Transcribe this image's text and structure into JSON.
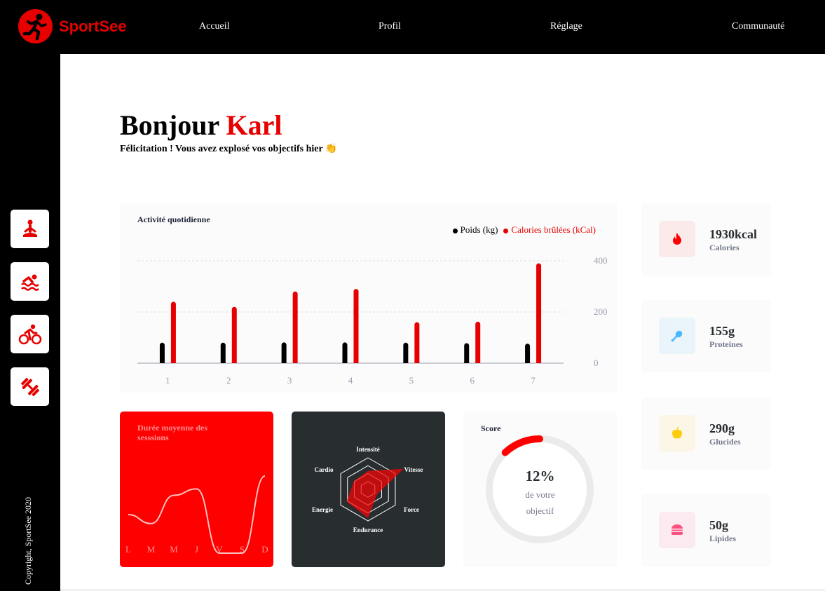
{
  "brand": {
    "name": "SportSee",
    "accent": "#e60000"
  },
  "nav": {
    "items": [
      "Accueil",
      "Profil",
      "Réglage",
      "Communauté"
    ]
  },
  "sidebar": {
    "icons": [
      "meditation-icon",
      "swimming-icon",
      "cycling-icon",
      "dumbbell-icon"
    ],
    "copyright": "Copyright, SportSee 2020"
  },
  "header": {
    "greeting": "Bonjour",
    "name": "Karl",
    "message": "Félicitation ! Vous avez explosé vos objectifs hier 👏"
  },
  "activity": {
    "title": "Activité quotidienne",
    "legend_weight": "Poids (kg)",
    "legend_calories": "Calories brûlées (kCal)"
  },
  "sessions": {
    "title": "Durée moyenne des sesssions"
  },
  "score": {
    "title": "Score",
    "value": "12%",
    "line1": "de votre",
    "line2": "objectif"
  },
  "nutrition": [
    {
      "value": "1930kcal",
      "label": "Calories",
      "icon": "fire-icon",
      "bg": "#fbeaea",
      "color": "#ff0000"
    },
    {
      "value": "155g",
      "label": "Proteines",
      "icon": "chicken-icon",
      "bg": "#e9f4fb",
      "color": "#4ab8ff"
    },
    {
      "value": "290g",
      "label": "Glucides",
      "icon": "apple-icon",
      "bg": "#fbf6e5",
      "color": "#fdcc0c"
    },
    {
      "value": "50g",
      "label": "Lipides",
      "icon": "burger-icon",
      "bg": "#fbeaef",
      "color": "#fd5181"
    }
  ],
  "chart_data": [
    {
      "type": "bar",
      "title": "Activité quotidienne",
      "categories": [
        "1",
        "2",
        "3",
        "4",
        "5",
        "6",
        "7"
      ],
      "series": [
        {
          "name": "Poids (kg)",
          "values": [
            80,
            80,
            81,
            81,
            80,
            78,
            76
          ],
          "color": "#000000"
        },
        {
          "name": "Calories brûlées (kCal)",
          "values": [
            240,
            220,
            280,
            290,
            160,
            162,
            390
          ],
          "color": "#e60000"
        }
      ],
      "yticks": [
        0,
        200,
        400
      ],
      "ylim": [
        0,
        400
      ],
      "y_axis_position": "right",
      "grid": "horizontal dashed"
    },
    {
      "type": "line",
      "title": "Durée moyenne des sesssions",
      "categories": [
        "L",
        "M",
        "M",
        "J",
        "V",
        "S",
        "D"
      ],
      "values": [
        30,
        23,
        45,
        50,
        0,
        0,
        60
      ]
    },
    {
      "type": "radar",
      "categories": [
        "Intensité",
        "Vitesse",
        "Force",
        "Endurance",
        "Energie",
        "Cardio"
      ],
      "values": [
        90,
        200,
        50,
        140,
        120,
        80
      ],
      "max": 200,
      "color": "#ff0101"
    },
    {
      "type": "radial",
      "title": "Score",
      "value": 0.12,
      "color": "#ff0000"
    }
  ]
}
